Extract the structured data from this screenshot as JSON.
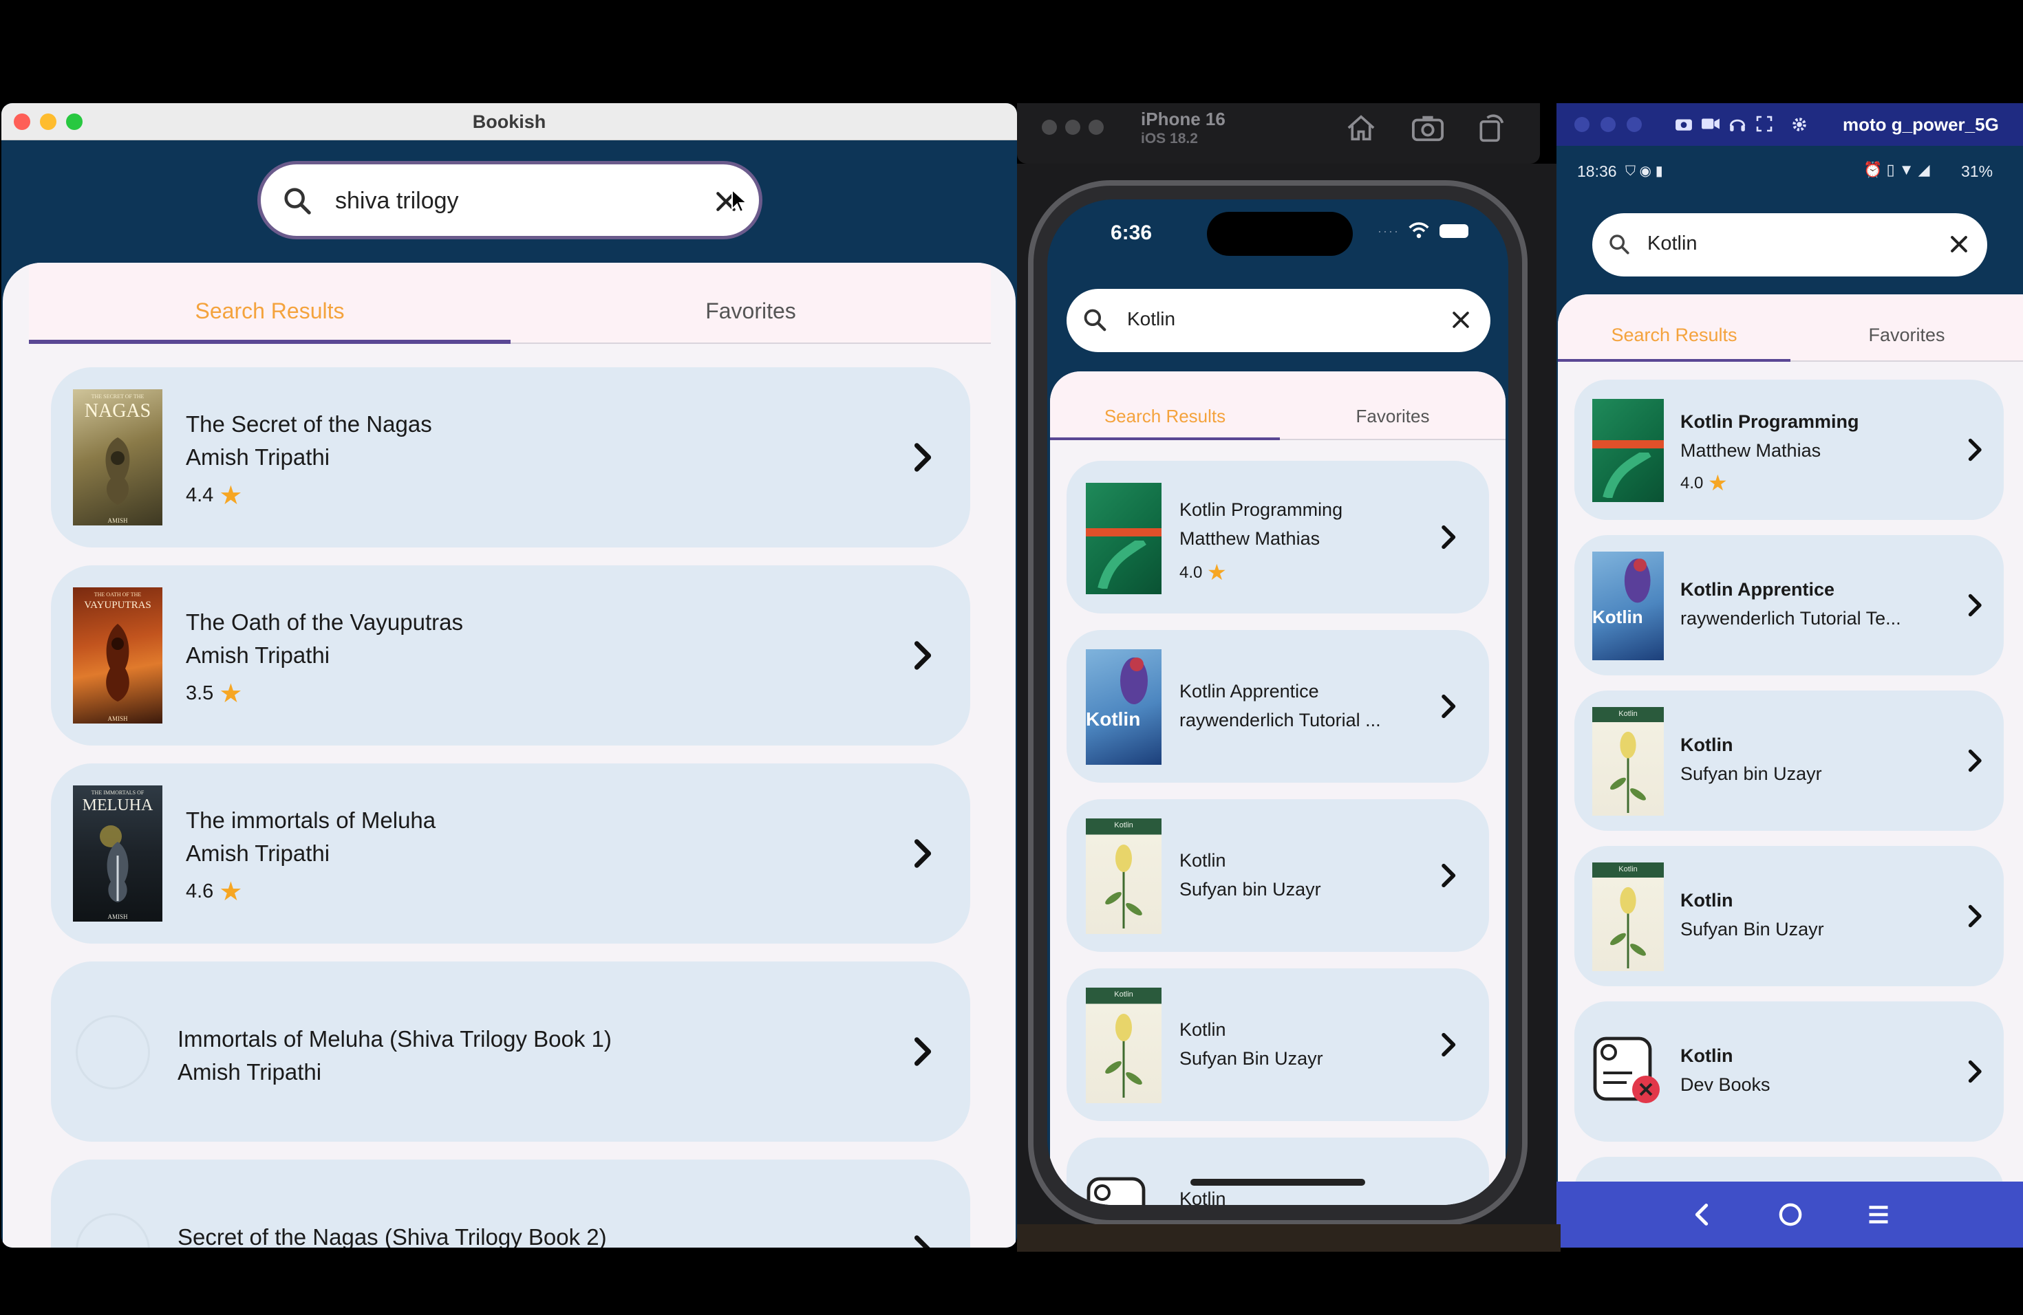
{
  "mac": {
    "window_title": "Bookish",
    "search_value": "shiva trilogy",
    "tabs": [
      "Search Results",
      "Favorites"
    ],
    "results": [
      {
        "title": "The Secret of the Nagas",
        "author": "Amish Tripathi",
        "rating": "4.4",
        "cover_text": "NAGAS",
        "cover_top": "THE SECRET OF THE",
        "cover_bottom": "AMISH"
      },
      {
        "title": "The Oath of the Vayuputras",
        "author": "Amish Tripathi",
        "rating": "3.5",
        "cover_text": "VAYUPUTRAS",
        "cover_top": "THE OATH OF THE",
        "cover_bottom": "AMISH"
      },
      {
        "title": "The immortals of Meluha",
        "author": "Amish Tripathi",
        "rating": "4.6",
        "cover_text": "MELUHA",
        "cover_top": "THE IMMORTALS OF",
        "cover_bottom": "AMISH"
      },
      {
        "title": "Immortals of Meluha (Shiva Trilogy Book 1)",
        "author": "Amish Tripathi"
      },
      {
        "title": "Secret of the Nagas (Shiva Trilogy Book 2)"
      }
    ]
  },
  "sim": {
    "device_name": "iPhone 16",
    "os_version": "iOS 18.2",
    "time": "6:36",
    "search_value": "Kotlin",
    "tabs": [
      "Search Results",
      "Favorites"
    ],
    "results": [
      {
        "title": "Kotlin Programming",
        "author": "Matthew Mathias",
        "rating": "4.0"
      },
      {
        "title": "Kotlin Apprentice",
        "author": "raywenderlich Tutorial ...",
        "cover_text": "Kotlin"
      },
      {
        "title": "Kotlin",
        "author": "Sufyan bin Uzayr",
        "cover_text": "Kotlin"
      },
      {
        "title": "Kotlin",
        "author": "Sufyan Bin Uzayr",
        "cover_text": "Kotlin"
      },
      {
        "title": "Kotlin"
      }
    ]
  },
  "android": {
    "device_name": "moto g_power_5G",
    "time": "18:36",
    "battery": "31%",
    "search_value": "Kotlin",
    "tabs": [
      "Search Results",
      "Favorites"
    ],
    "results": [
      {
        "title": "Kotlin Programming",
        "author": "Matthew Mathias",
        "rating": "4.0"
      },
      {
        "title": "Kotlin Apprentice",
        "author": "raywenderlich Tutorial Te...",
        "cover_text": "Kotlin"
      },
      {
        "title": "Kotlin",
        "author": "Sufyan bin Uzayr",
        "cover_text": "Kotlin"
      },
      {
        "title": "Kotlin",
        "author": "Sufyan Bin Uzayr",
        "cover_text": "Kotlin"
      },
      {
        "title": "Kotlin",
        "author": "Dev Books"
      }
    ]
  },
  "icons": {
    "search": "search-icon",
    "clear": "close-icon",
    "chevron": "chevron-right-icon",
    "star": "star-icon"
  },
  "colors": {
    "navy": "#0d3557",
    "card": "#dfe9f3",
    "accent": "#f4a33d",
    "indicator": "#5a4794",
    "star": "#f6a623"
  }
}
